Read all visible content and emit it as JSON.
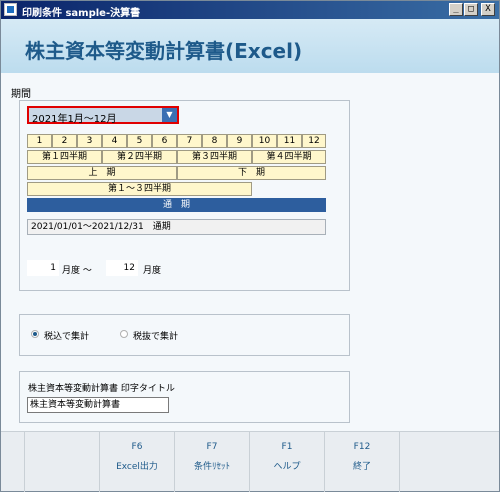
{
  "window": {
    "title": "印刷条件 sample-決算書",
    "minimize": "_",
    "maximize": "□",
    "close": "X"
  },
  "banner": {
    "title": "株主資本等変動計算書(Excel)"
  },
  "period": {
    "section_label": "期間",
    "selected": "2021年1月～12月",
    "months": [
      "1",
      "2",
      "3",
      "4",
      "5",
      "6",
      "7",
      "8",
      "9",
      "10",
      "11",
      "12"
    ],
    "quarters": [
      "第１四半期",
      "第２四半期",
      "第３四半期",
      "第４四半期"
    ],
    "halves": [
      "上　期",
      "下　期"
    ],
    "q1to3": "第１～３四半期",
    "full_year": "通　期",
    "range_text": "2021/01/01～2021/12/31　通期",
    "from_month": "1",
    "from_unit": "月度 ～",
    "to_month": "12",
    "to_unit": "月度"
  },
  "tax": {
    "included": "税込で集計",
    "excluded": "税抜で集計",
    "selected": "included"
  },
  "print_title": {
    "label": "株主資本等変動計算書 印字タイトル",
    "value": "株主資本等変動計算書"
  },
  "fkeys": [
    {
      "key": "",
      "label": ""
    },
    {
      "key": "F6",
      "label": "Excel出力"
    },
    {
      "key": "F7",
      "label": "条件ﾘｾｯﾄ"
    },
    {
      "key": "F1",
      "label": "ヘルプ"
    },
    {
      "key": "F12",
      "label": "終了"
    },
    {
      "key": "",
      "label": ""
    }
  ],
  "colors": {
    "accent": "#1e5a8a",
    "banner": "#c9e2f1",
    "period_cell": "#fff7cc",
    "full_year_cell": "#2d5e9e",
    "select_border": "#e00000"
  }
}
